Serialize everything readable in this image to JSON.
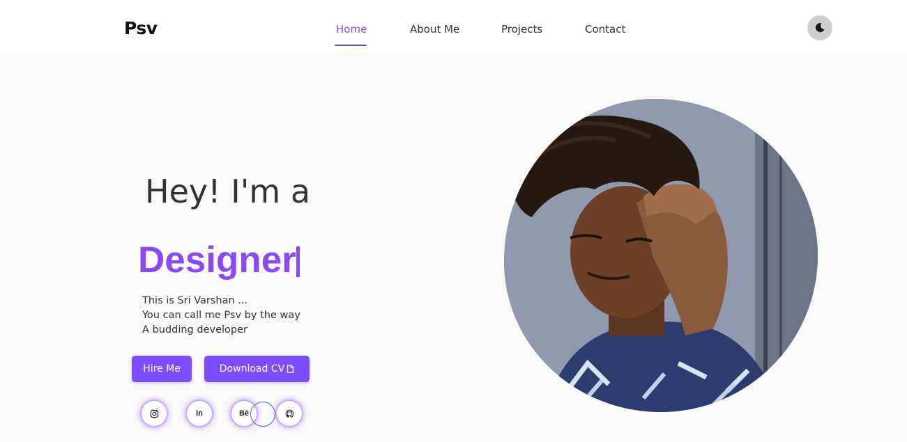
{
  "brand": {
    "logo": "Psv"
  },
  "nav": {
    "links": [
      {
        "label": "Home",
        "active": true
      },
      {
        "label": "About Me",
        "active": false
      },
      {
        "label": "Projects",
        "active": false
      },
      {
        "label": "Contact",
        "active": false
      }
    ],
    "theme_toggle_icon": "moon-icon"
  },
  "hero": {
    "greeting": "Hey! I'm a",
    "role": "Designer",
    "bio": [
      "This is Sri Varshan ...",
      "You can call me Psv by the way",
      "A budding developer"
    ],
    "buttons": {
      "hire": "Hire Me",
      "download_cv": "Download CV"
    },
    "social": [
      {
        "icon": "instagram-icon"
      },
      {
        "icon": "linkedin-icon",
        "text": "in"
      },
      {
        "icon": "behance-icon",
        "text": "Bē"
      },
      {
        "icon": "github-icon"
      }
    ]
  },
  "colors": {
    "accent": "#7c4dff",
    "role_text": "#8a4af3",
    "nav_bg": "#ffffff",
    "page_bg": "#f9f9f9"
  }
}
